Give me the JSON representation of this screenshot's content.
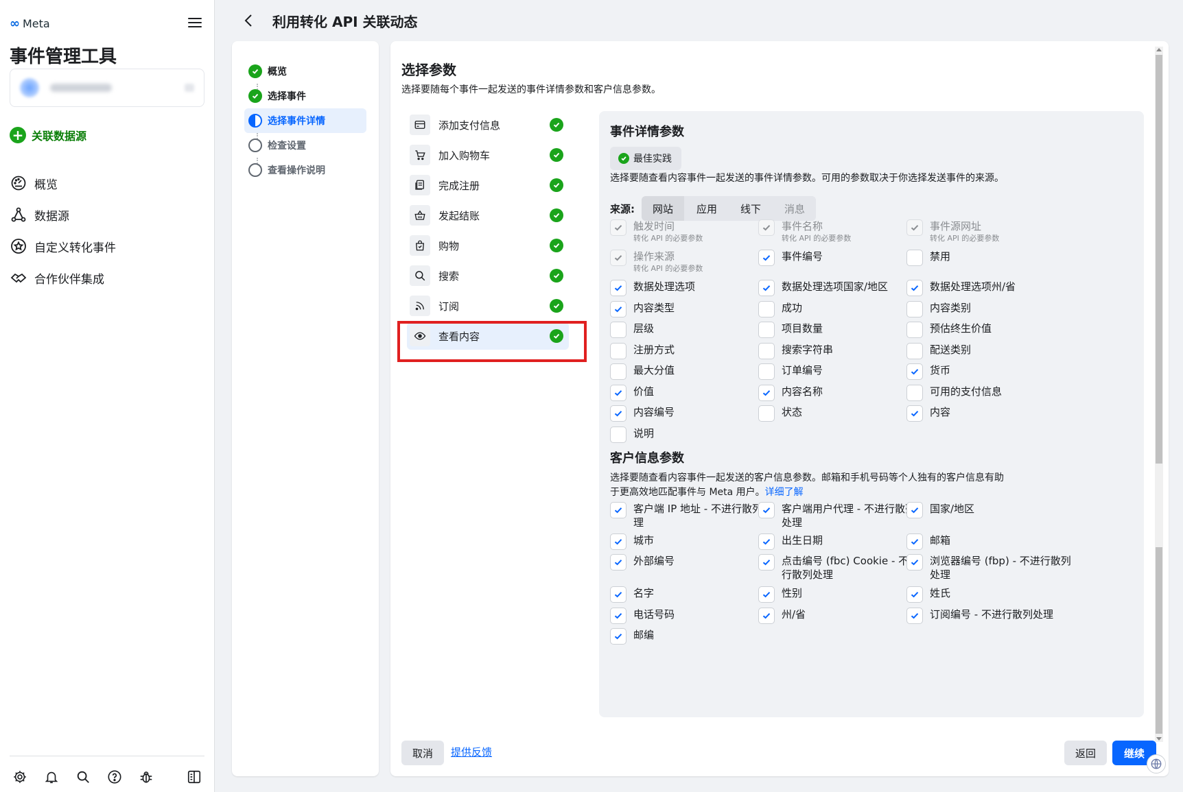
{
  "sidebar": {
    "logo_text": "Meta",
    "app_title": "事件管理工具",
    "connect_label": "关联数据源",
    "nav": [
      {
        "label": "概览",
        "icon": "dashboard-icon"
      },
      {
        "label": "数据源",
        "icon": "data-sources-icon"
      },
      {
        "label": "自定义转化事件",
        "icon": "star-badge-icon"
      },
      {
        "label": "合作伙伴集成",
        "icon": "handshake-icon"
      }
    ],
    "footer_icons": [
      "settings-icon",
      "bell-icon",
      "search-icon",
      "help-icon",
      "bug-icon",
      "panel-toggle-icon"
    ]
  },
  "header": {
    "title": "利用转化 API 关联动态"
  },
  "steps": [
    {
      "label": "概览",
      "state": "done"
    },
    {
      "label": "选择事件",
      "state": "done"
    },
    {
      "label": "选择事件详情",
      "state": "active"
    },
    {
      "label": "检查设置",
      "state": "pending"
    },
    {
      "label": "查看操作说明",
      "state": "pending"
    }
  ],
  "main": {
    "title": "选择参数",
    "subtitle": "选择要随每个事件一起发送的事件详情参数和客户信息参数。",
    "events": [
      {
        "label": "添加支付信息",
        "icon": "card-icon"
      },
      {
        "label": "加入购物车",
        "icon": "cart-icon"
      },
      {
        "label": "完成注册",
        "icon": "registration-icon"
      },
      {
        "label": "发起结账",
        "icon": "basket-icon"
      },
      {
        "label": "购物",
        "icon": "shopping-bag-icon"
      },
      {
        "label": "搜索",
        "icon": "search-icon"
      },
      {
        "label": "订阅",
        "icon": "rss-icon"
      },
      {
        "label": "查看内容",
        "icon": "eye-icon"
      }
    ],
    "selected_event_index": 7,
    "event_details": {
      "title": "事件详情参数",
      "best_practice": "最佳实践",
      "description": "选择要随查看内容事件一起发送的事件详情参数。可用的参数取决于你选择发送事件的来源。",
      "source_label": "来源:",
      "sources": [
        "网站",
        "应用",
        "线下",
        "消息"
      ],
      "required_note": "转化 API 的必要参数",
      "params": [
        {
          "label": "触发时间",
          "checked": true,
          "disabled": true,
          "required": true
        },
        {
          "label": "事件名称",
          "checked": true,
          "disabled": true,
          "required": true
        },
        {
          "label": "事件源网址",
          "checked": true,
          "disabled": true,
          "required": true
        },
        {
          "label": "操作来源",
          "checked": true,
          "disabled": true,
          "required": true
        },
        {
          "label": "事件编号",
          "checked": true
        },
        {
          "label": "禁用",
          "checked": false
        },
        {
          "label": "数据处理选项",
          "checked": true
        },
        {
          "label": "数据处理选项国家/地区",
          "checked": true
        },
        {
          "label": "数据处理选项州/省",
          "checked": true
        },
        {
          "label": "内容类型",
          "checked": true
        },
        {
          "label": "成功",
          "checked": false
        },
        {
          "label": "内容类别",
          "checked": false
        },
        {
          "label": "层级",
          "checked": false
        },
        {
          "label": "项目数量",
          "checked": false
        },
        {
          "label": "预估终生价值",
          "checked": false
        },
        {
          "label": "注册方式",
          "checked": false
        },
        {
          "label": "搜索字符串",
          "checked": false
        },
        {
          "label": "配送类别",
          "checked": false
        },
        {
          "label": "最大分值",
          "checked": false
        },
        {
          "label": "订单编号",
          "checked": false
        },
        {
          "label": "货币",
          "checked": true
        },
        {
          "label": "价值",
          "checked": true
        },
        {
          "label": "内容名称",
          "checked": true
        },
        {
          "label": "可用的支付信息",
          "checked": false
        },
        {
          "label": "内容编号",
          "checked": true
        },
        {
          "label": "状态",
          "checked": false
        },
        {
          "label": "内容",
          "checked": true
        },
        {
          "label": "说明",
          "checked": false
        }
      ]
    },
    "customer_info": {
      "title": "客户信息参数",
      "description_line1": "选择要随查看内容事件一起发送的客户信息参数。邮箱和手机号码等个人独有的客户信息有助",
      "description_line2": "于更高效地匹配事件与 Meta 用户。",
      "learn_more": "详细了解",
      "params": [
        {
          "line1": "客户端 IP 地址 - 不进行散列处",
          "line2": "理",
          "checked": true
        },
        {
          "line1": "客户端用户代理 - 不进行散列",
          "line2": "处理",
          "checked": true
        },
        {
          "line1": "国家/地区",
          "line2": "",
          "checked": true
        },
        {
          "line1": "城市",
          "line2": "",
          "checked": true
        },
        {
          "line1": "出生日期",
          "line2": "",
          "checked": true
        },
        {
          "line1": "邮箱",
          "line2": "",
          "checked": true
        },
        {
          "line1": "外部编号",
          "line2": "",
          "checked": true
        },
        {
          "line1": "点击编号 (fbc) Cookie - 不进",
          "line2": "行散列处理",
          "checked": true
        },
        {
          "line1": "浏览器编号 (fbp) - 不进行散列",
          "line2": "处理",
          "checked": true
        },
        {
          "line1": "名字",
          "line2": "",
          "checked": true
        },
        {
          "line1": "性别",
          "line2": "",
          "checked": true
        },
        {
          "line1": "姓氏",
          "line2": "",
          "checked": true
        },
        {
          "line1": "电话号码",
          "line2": "",
          "checked": true
        },
        {
          "line1": "州/省",
          "line2": "",
          "checked": true
        },
        {
          "line1": "订阅编号 - 不进行散列处理",
          "line2": "",
          "checked": true
        },
        {
          "line1": "邮编",
          "line2": "",
          "checked": true
        }
      ]
    },
    "footer": {
      "cancel": "取消",
      "feedback": "提供反馈",
      "back": "返回",
      "continue": "继续"
    }
  },
  "colors": {
    "accent": "#0866ff",
    "success": "#1aa41b",
    "highlight": "#e02020",
    "brand_green_text": "#0a7e07"
  }
}
